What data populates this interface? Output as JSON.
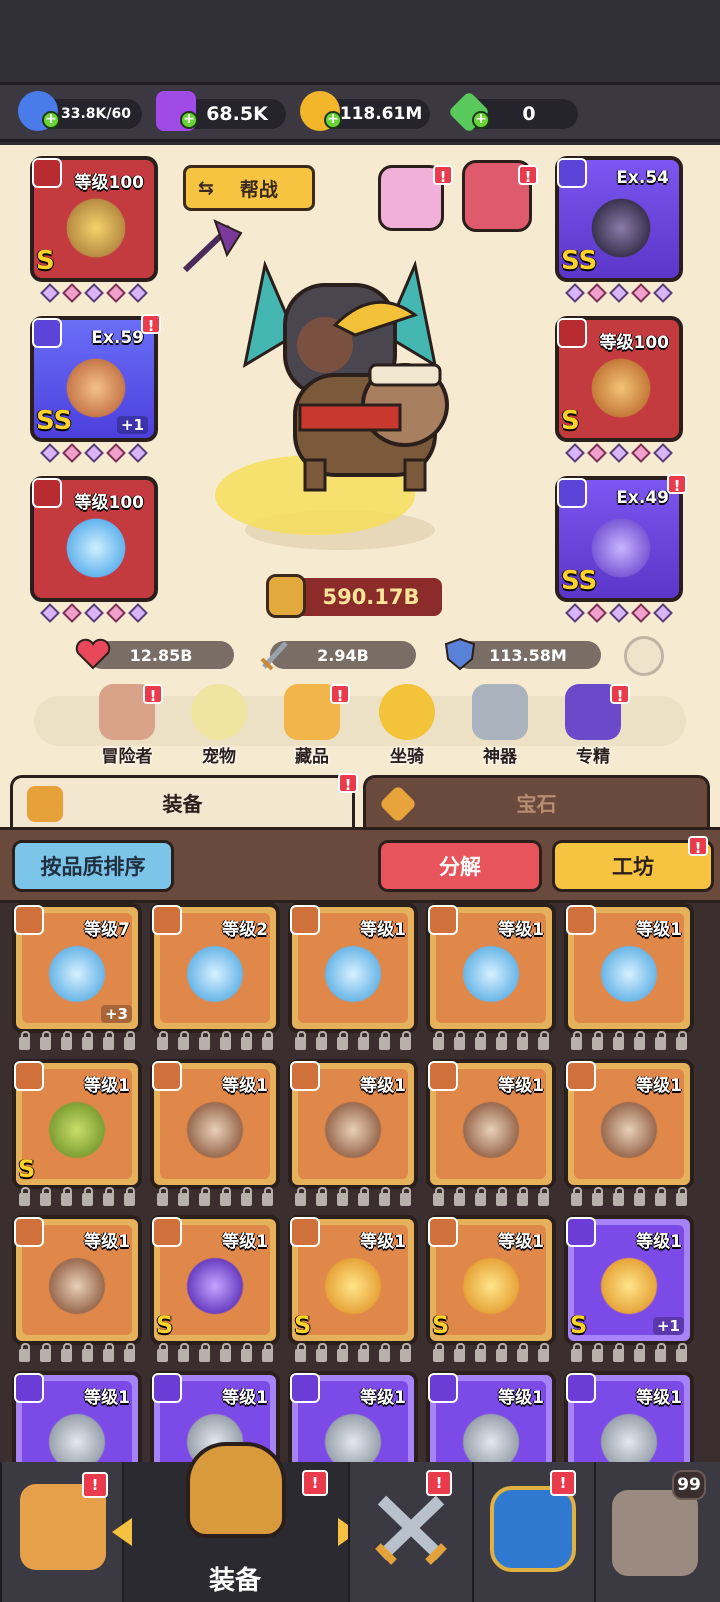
{
  "resources": {
    "energy": "33.8K/60",
    "gems": "68.5K",
    "gold": "118.61M",
    "crystal": "0"
  },
  "assist_button": "帮战",
  "equipment_slots": [
    {
      "label": "等级100",
      "grade": "S",
      "color": "red"
    },
    {
      "label": "Ex.54",
      "grade": "SS",
      "color": "purple"
    },
    {
      "label": "Ex.59",
      "grade": "SS",
      "color": "blue",
      "plus": "+1"
    },
    {
      "label": "等级100",
      "grade": "S",
      "color": "red"
    },
    {
      "label": "等级100",
      "grade": "",
      "color": "red"
    },
    {
      "label": "Ex.49",
      "grade": "SS",
      "color": "purple"
    }
  ],
  "power": "590.17B",
  "stats": {
    "hp": "12.85B",
    "attack": "2.94B",
    "defense": "113.58M"
  },
  "features": [
    "冒险者",
    "宠物",
    "藏品",
    "坐骑",
    "神器",
    "专精"
  ],
  "tabs": {
    "equipment": "装备",
    "gem": "宝石"
  },
  "buttons": {
    "sort": "按品质排序",
    "decompose": "分解",
    "workshop": "工坊"
  },
  "inventory": [
    {
      "level": "等级7",
      "grade": "",
      "plus": "+3",
      "color": "orange",
      "art": "staff"
    },
    {
      "level": "等级2",
      "grade": "",
      "plus": "",
      "color": "orange",
      "art": "staff"
    },
    {
      "level": "等级1",
      "grade": "",
      "plus": "",
      "color": "orange",
      "art": "staff"
    },
    {
      "level": "等级1",
      "grade": "",
      "plus": "",
      "color": "orange",
      "art": "staff"
    },
    {
      "level": "等级1",
      "grade": "",
      "plus": "",
      "color": "orange",
      "art": "staff"
    },
    {
      "level": "等级1",
      "grade": "S",
      "plus": "",
      "color": "orange",
      "art": "mace"
    },
    {
      "level": "等级1",
      "grade": "",
      "plus": "",
      "color": "orange",
      "art": "armor"
    },
    {
      "level": "等级1",
      "grade": "",
      "plus": "",
      "color": "orange",
      "art": "armor"
    },
    {
      "level": "等级1",
      "grade": "",
      "plus": "",
      "color": "orange",
      "art": "armor"
    },
    {
      "level": "等级1",
      "grade": "",
      "plus": "",
      "color": "orange",
      "art": "armor"
    },
    {
      "level": "等级1",
      "grade": "",
      "plus": "",
      "color": "orange",
      "art": "armor"
    },
    {
      "level": "等级1",
      "grade": "S",
      "plus": "",
      "color": "orange",
      "art": "cape"
    },
    {
      "level": "等级1",
      "grade": "S",
      "plus": "",
      "color": "orange",
      "art": "amulet"
    },
    {
      "level": "等级1",
      "grade": "S",
      "plus": "",
      "color": "orange",
      "art": "amulet"
    },
    {
      "level": "等级1",
      "grade": "S",
      "plus": "+1",
      "color": "purple",
      "art": "amulet"
    },
    {
      "level": "等级1",
      "grade": "",
      "plus": "",
      "color": "purple",
      "art": "blade"
    },
    {
      "level": "等级1",
      "grade": "",
      "plus": "",
      "color": "purple",
      "art": "blade"
    },
    {
      "level": "等级1",
      "grade": "",
      "plus": "",
      "color": "purple",
      "art": "blade"
    },
    {
      "level": "等级1",
      "grade": "",
      "plus": "",
      "color": "purple",
      "art": "blade"
    },
    {
      "level": "等级1",
      "grade": "",
      "plus": "",
      "color": "purple",
      "art": "blade"
    }
  ],
  "nav": {
    "active_label": "装备",
    "chest_count": "99"
  }
}
